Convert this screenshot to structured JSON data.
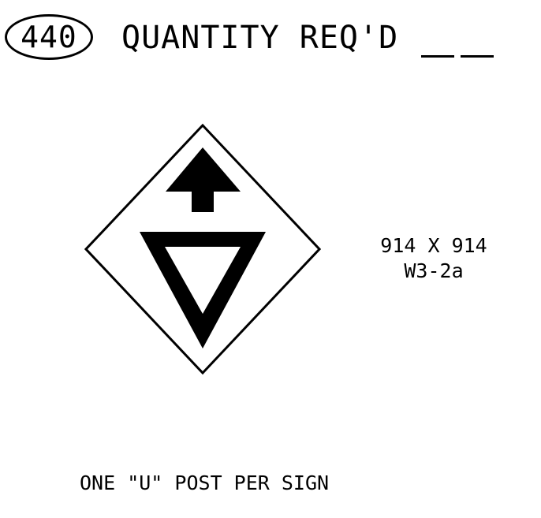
{
  "header": {
    "item_number": "440",
    "title": "QUANTITY REQ'D"
  },
  "sign": {
    "icon": "diamond-warning-sign-arrow-yield",
    "size": "914 X 914",
    "code": "W3-2a"
  },
  "note": "ONE \"U\" POST PER SIGN",
  "colors": {
    "ink": "#000000",
    "background": "#ffffff"
  }
}
